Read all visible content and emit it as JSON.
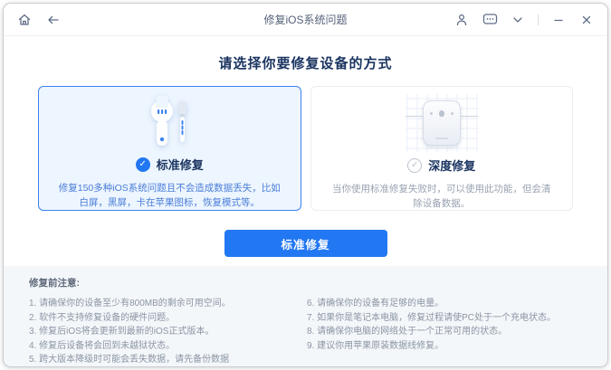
{
  "titlebar": {
    "title": "修复iOS系统问题"
  },
  "selection": {
    "heading": "请选择你要修复设备的方式",
    "cards": [
      {
        "title": "标准修复",
        "description": "修复150多种iOS系统问题且不会造成数据丢失，比如白屏，黑屏，卡在苹果图标，恢复模式等。",
        "selected": true
      },
      {
        "title": "深度修复",
        "description": "当你使用标准修复失败时，可以使用此功能，但会清除设备数据。",
        "selected": false
      }
    ],
    "check_glyph": "✓",
    "primary_button": "标准修复"
  },
  "footer": {
    "heading": "修复前注意:",
    "notes_left": [
      "1. 请确保你的设备至少有800MB的剩余可用空间。",
      "2. 软件不支持修复设备的硬件问题。",
      "3. 修复后iOS将会更新到最新的iOS正式版本。",
      "4. 修复后设备将会回到未越狱状态。",
      "5. 跨大版本降级时可能会丢失数据，请先备份数据"
    ],
    "notes_right": [
      "6. 请确保你的设备有足够的电量。",
      "7. 如果你是笔记本电脑，修复过程请使PC处于一个充电状态。",
      "8. 请确保你电脑的网络处于一个正常可用的状态。",
      "9. 建议你用苹果原装数据线修复。"
    ]
  },
  "colors": {
    "accent": "#2277f2",
    "card-selected-bg": "#edf5fe",
    "card-selected-border": "#3b82f0",
    "heading-color": "#1b3561",
    "desc-blue": "#4a7ed9",
    "desc-gray": "#9aa3b2",
    "footer-bg": "#f4f7fa",
    "footer-text": "#8b95a3",
    "titlebar-icon": "#5f6e87"
  }
}
